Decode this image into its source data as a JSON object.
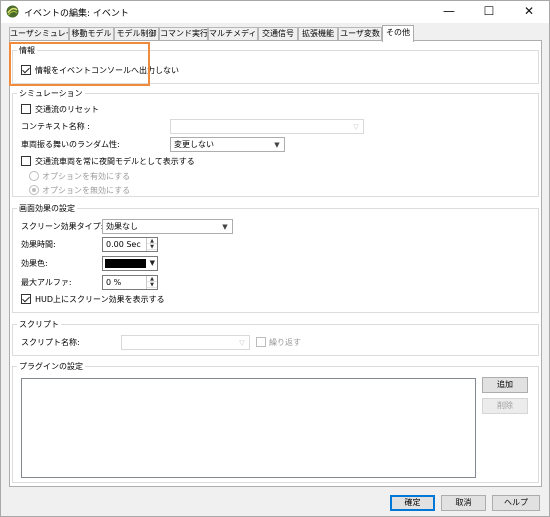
{
  "window": {
    "title": "イベントの編集: イベント",
    "minimize_glyph": "—",
    "maximize_glyph": "☐",
    "close_glyph": "✕"
  },
  "tabs": [
    {
      "label": "ユーザシミュレーション",
      "active": false
    },
    {
      "label": "移動モデル",
      "active": false
    },
    {
      "label": "モデル制御",
      "active": false
    },
    {
      "label": "コマンド実行",
      "active": false
    },
    {
      "label": "マルチメディア",
      "active": false
    },
    {
      "label": "交通信号",
      "active": false
    },
    {
      "label": "拡張機能",
      "active": false
    },
    {
      "label": "ユーザ変数",
      "active": false
    },
    {
      "label": "その他",
      "active": true
    }
  ],
  "info": {
    "group_label": "情報",
    "output_to_console_label": "情報をイベントコンソールへ出力しない",
    "output_to_console_checked": true
  },
  "simulation": {
    "group_label": "シミュレーション",
    "traffic_reset_label": "交通流のリセット",
    "traffic_reset_checked": false,
    "context_name_label": "コンテキスト名称 :",
    "context_name_value": "",
    "vehicle_random_label": "車両振る舞いのランダム性:",
    "vehicle_random_value": "変更しない",
    "night_model_label": "交通流車両を常に夜間モデルとして表示する",
    "night_model_checked": false,
    "option_enable_label": "オプションを有効にする",
    "option_disable_label": "オプションを無効にする",
    "option_selected": "disable"
  },
  "screen_effect": {
    "group_label": "画面効果の設定",
    "effect_type_label": "スクリーン効果タイプ:",
    "effect_type_value": "効果なし",
    "effect_time_label": "効果時間:",
    "effect_time_value": "0.00 Sec",
    "effect_color_label": "効果色:",
    "effect_color": "#000000",
    "max_alpha_label": "最大アルファ:",
    "max_alpha_value": "0 %",
    "hud_label": "HUD上にスクリーン効果を表示する",
    "hud_checked": true
  },
  "script": {
    "group_label": "スクリプト",
    "script_name_label": "スクリプト名称:",
    "script_name_value": "",
    "repeat_label": "繰り返す",
    "repeat_checked": false
  },
  "plugin": {
    "group_label": "プラグインの設定",
    "add_button": "追加",
    "delete_button": "削除",
    "items": []
  },
  "footer": {
    "ok_button": "確定",
    "cancel_button": "取消",
    "help_button": "ヘルプ"
  },
  "colors": {
    "highlight_border": "#f08a3c",
    "default_button_border": "#0078d7"
  }
}
